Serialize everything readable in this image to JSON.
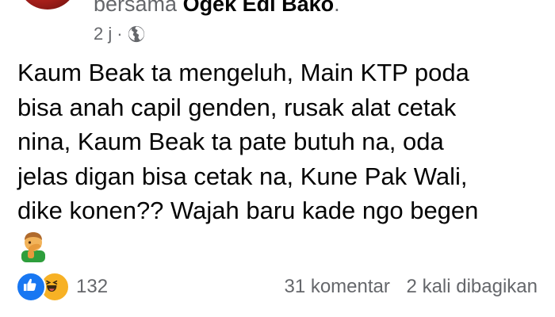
{
  "post": {
    "author_prefix": "bersama",
    "author_name": "Ogek Edi Bako",
    "author_suffix": ".",
    "time": "2 j",
    "separator": "·",
    "privacy_icon": "globe-icon",
    "text_lines": [
      "Kaum Beak ta mengeluh, Main KTP poda",
      "bisa anah capil genden, rusak alat cetak",
      "nina, Kaum Beak ta pate butuh na, oda",
      "jelas digan bisa cetak na, Kune Pak Wali,",
      "dike konen?? Wajah baru kade ngo begen"
    ],
    "trailing_emoji": "man-facepalming-emoji"
  },
  "footer": {
    "reaction_icons": [
      "like-icon",
      "haha-icon"
    ],
    "reaction_count": "132",
    "comments": "31 komentar",
    "shares": "2 kali dibagikan"
  },
  "colors": {
    "secondary_text": "#65676b",
    "primary_text": "#050505",
    "like_blue": "#1877f2",
    "haha_yellow": "#f7b125"
  }
}
